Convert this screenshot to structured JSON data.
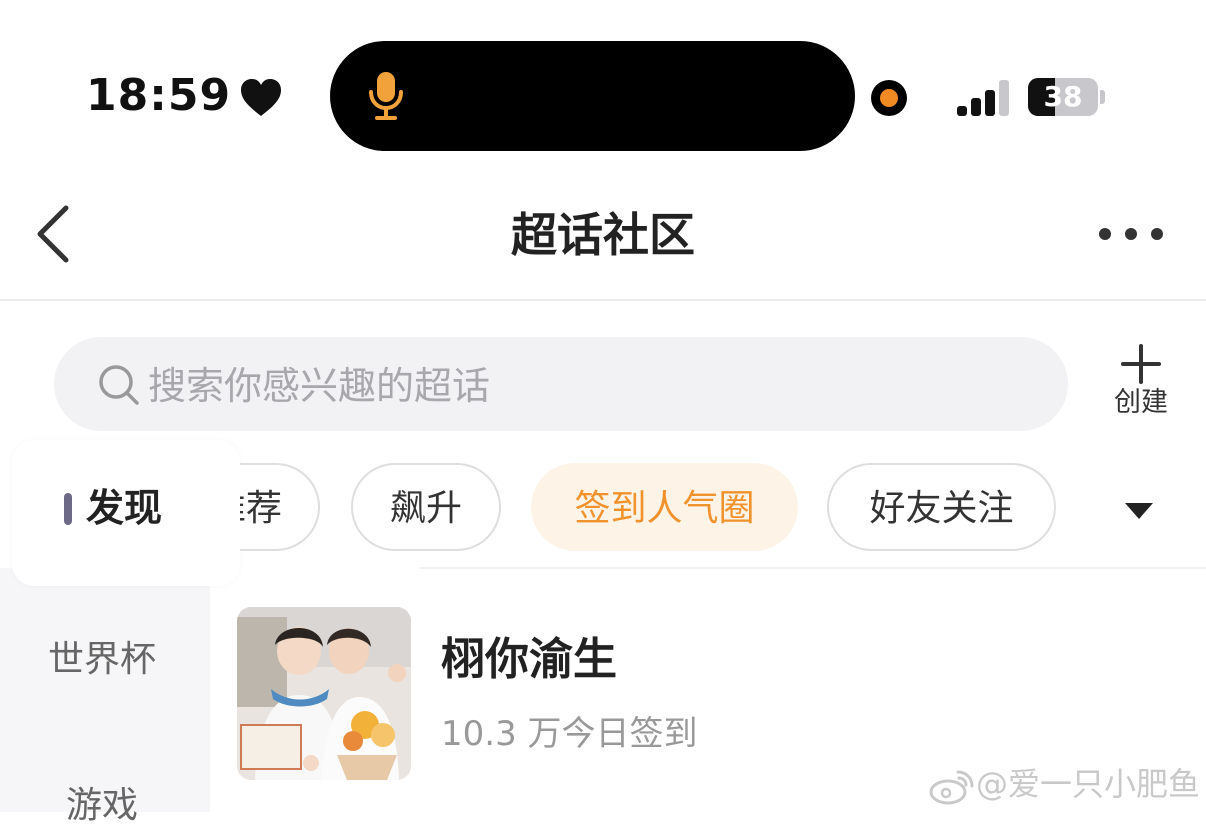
{
  "status_bar": {
    "time": "18:59",
    "battery": "38",
    "battery_level": 0.38,
    "signal_bars_active": 3,
    "icons": [
      "heart-icon",
      "microphone-icon",
      "recording-dot-icon",
      "signal-icon",
      "battery-icon"
    ],
    "accent_color": "#f28a24"
  },
  "nav": {
    "title": "超话社区",
    "back_icon": "chevron-left-icon",
    "more_icon": "more-dots-icon"
  },
  "search": {
    "placeholder": "搜索你感兴趣的超话",
    "icon": "search-icon"
  },
  "create": {
    "label": "创建",
    "icon": "plus-icon"
  },
  "sidebar": {
    "selected": "发现",
    "items": [
      {
        "label": "发现"
      },
      {
        "label": "世界杯"
      },
      {
        "label": "游戏"
      }
    ]
  },
  "tabs": {
    "items": [
      {
        "label": "推荐"
      },
      {
        "label": "飙升"
      },
      {
        "label": "签到人气圈"
      },
      {
        "label": "好友关注"
      }
    ],
    "active": "签到人气圈",
    "active_color": "#f2922c",
    "dropdown_icon": "caret-down-icon"
  },
  "topics": [
    {
      "name": "栩你渝生",
      "checkins": "10.3 万今日签到",
      "thumbnail": "two-people-photo"
    }
  ],
  "watermark": {
    "text": "@爱一只小肥鱼",
    "icon": "weibo-icon"
  }
}
